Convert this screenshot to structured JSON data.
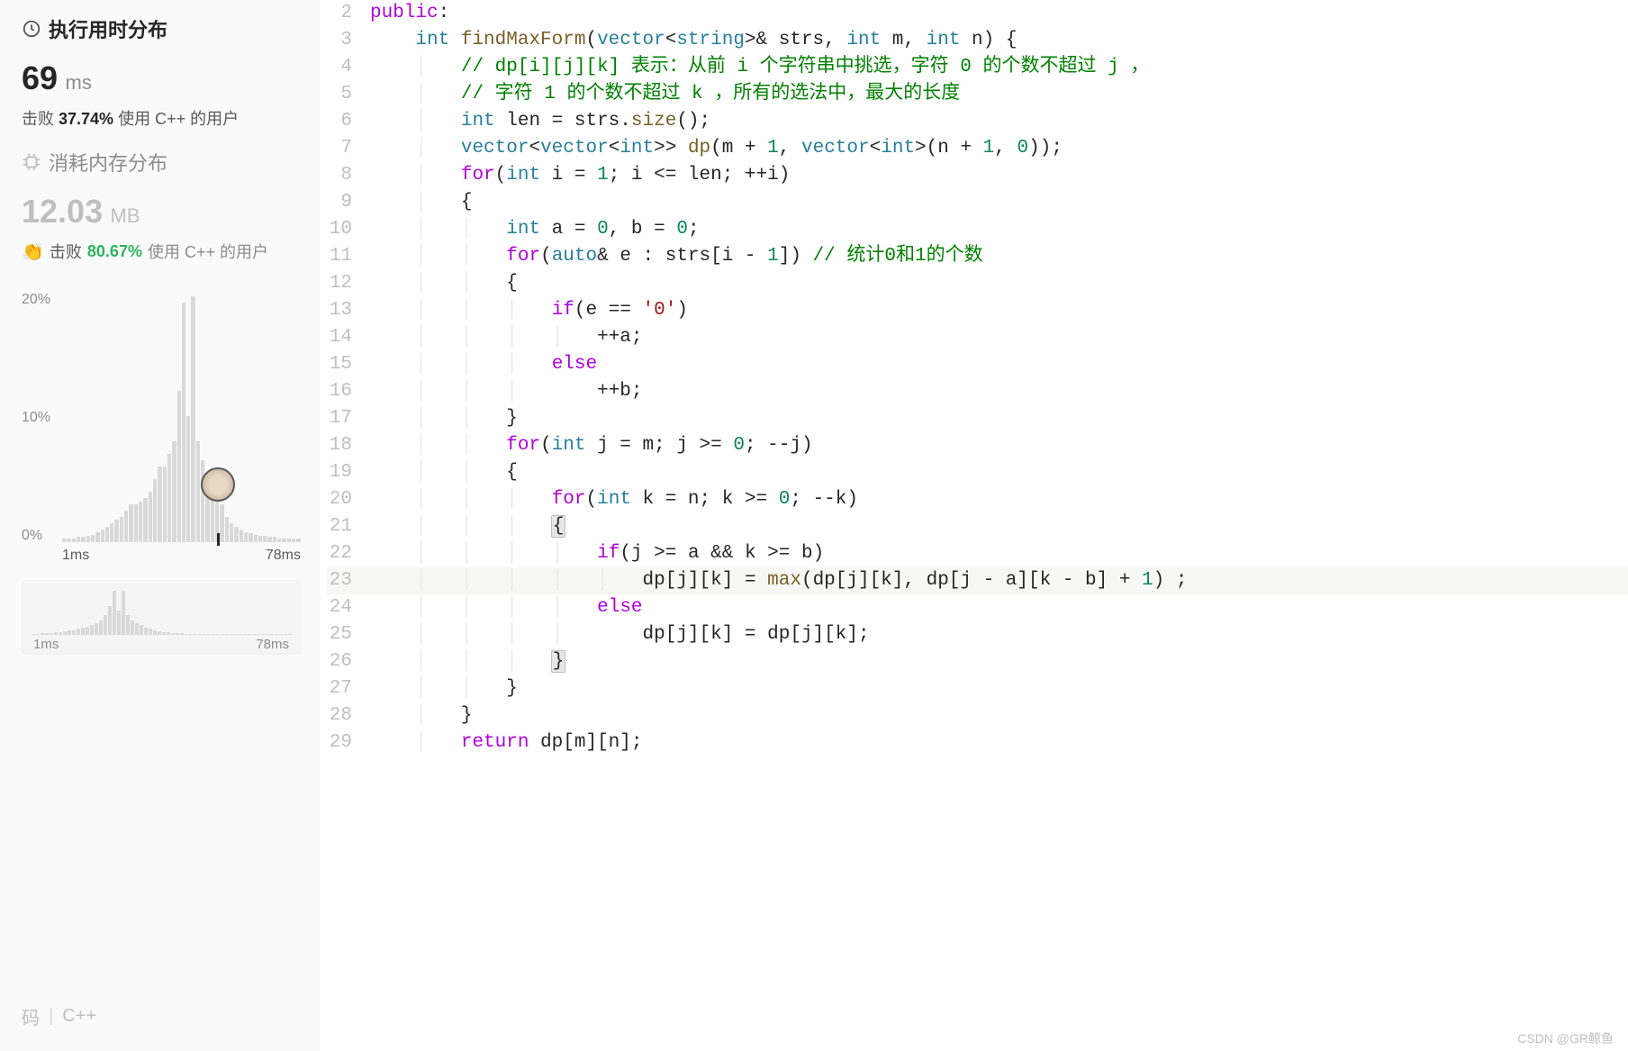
{
  "sidebar": {
    "runtime": {
      "header": "执行用时分布",
      "value": "69",
      "unit": "ms",
      "beat_label": "击败",
      "beat_pct": "37.74%",
      "beat_suffix": "使用 C++ 的用户"
    },
    "memory": {
      "header": "消耗内存分布",
      "value": "12.03",
      "unit": "MB",
      "beat_label": "击败",
      "beat_pct": "80.67%",
      "beat_suffix": "使用 C++ 的用户"
    },
    "y_axis": {
      "top": "20%",
      "mid": "10%",
      "bot": "0%"
    },
    "x_axis": {
      "left": "1ms",
      "right": "78ms"
    },
    "mini_x": {
      "left": "1ms",
      "right": "78ms"
    },
    "bottom": {
      "code": "码",
      "lang": "C++"
    }
  },
  "chart_data": {
    "type": "bar",
    "title": "执行用时分布",
    "xlabel": "ms",
    "ylabel": "percent",
    "ylim": [
      0,
      20
    ],
    "x_range": [
      "1ms",
      "78ms"
    ],
    "bars_pct": [
      0.3,
      0.3,
      0.3,
      0.4,
      0.4,
      0.5,
      0.6,
      0.8,
      1.0,
      1.2,
      1.5,
      1.8,
      2.0,
      2.5,
      3.0,
      3.0,
      3.2,
      3.5,
      4.0,
      5.0,
      6.0,
      6.0,
      7.0,
      8.0,
      12.0,
      19.0,
      10.0,
      19.5,
      8.0,
      6.5,
      5.0,
      4.0,
      4.0,
      3.0,
      2.0,
      1.5,
      1.2,
      1.0,
      0.8,
      0.7,
      0.6,
      0.5,
      0.5,
      0.4,
      0.4,
      0.3,
      0.3,
      0.3,
      0.3,
      0.3
    ],
    "mini_bars_pct": [
      0.5,
      0.5,
      0.6,
      0.7,
      0.8,
      1.0,
      1.2,
      1.5,
      1.8,
      2.0,
      2.5,
      3.0,
      3.5,
      4.0,
      5.0,
      6.0,
      8.0,
      12.0,
      18.0,
      10.0,
      18.0,
      8.0,
      6.0,
      5.0,
      4.0,
      3.0,
      2.5,
      2.0,
      1.5,
      1.2,
      1.0,
      0.8,
      0.7,
      0.6,
      0.5,
      0.5,
      0.4,
      0.4,
      0.4,
      0.3,
      0.3,
      0.3,
      0.3,
      0.3,
      0.3,
      0.2,
      0.2,
      0.2,
      0.2,
      0.2,
      0.2,
      0.2,
      0.2,
      0.2,
      0.2,
      0.2,
      0.2,
      0.2
    ]
  },
  "code": {
    "lines": [
      {
        "n": 2,
        "html": "<span class='kw'>public</span>:"
      },
      {
        "n": 3,
        "html": "    <span class='type'>int</span> <span class='fn'>findMaxForm</span>(<span class='type'>vector</span>&lt;<span class='type'>string</span>&gt;&amp; strs, <span class='type'>int</span> m, <span class='type'>int</span> n) {"
      },
      {
        "n": 4,
        "html": "    <span class='indent-guide'>│</span>   <span class='com'>// dp[i][j][k] 表示：从前 i 个字符串中挑选，字符 0 的个数不超过 j ，</span>"
      },
      {
        "n": 5,
        "html": "    <span class='indent-guide'>│</span>   <span class='com'>// 字符 1 的个数不超过 k ，所有的选法中，最大的长度</span>"
      },
      {
        "n": 6,
        "html": "    <span class='indent-guide'>│</span>   <span class='type'>int</span> len = strs.<span class='fn'>size</span>();"
      },
      {
        "n": 7,
        "html": "    <span class='indent-guide'>│</span>   <span class='type'>vector</span>&lt;<span class='type'>vector</span>&lt;<span class='type'>int</span>&gt;&gt; <span class='fn'>dp</span>(m + <span class='num'>1</span>, <span class='type'>vector</span>&lt;<span class='type'>int</span>&gt;(n + <span class='num'>1</span>, <span class='num'>0</span>));"
      },
      {
        "n": 8,
        "html": "    <span class='indent-guide'>│</span>   <span class='kw'>for</span>(<span class='type'>int</span> i = <span class='num'>1</span>; i &lt;= len; ++i)"
      },
      {
        "n": 9,
        "html": "    <span class='indent-guide'>│</span>   {"
      },
      {
        "n": 10,
        "html": "    <span class='indent-guide'>│</span>   <span class='indent-guide'>│</span>   <span class='type'>int</span> a = <span class='num'>0</span>, b = <span class='num'>0</span>;"
      },
      {
        "n": 11,
        "html": "    <span class='indent-guide'>│</span>   <span class='indent-guide'>│</span>   <span class='kw'>for</span>(<span class='type'>auto</span>&amp; e : strs[i - <span class='num'>1</span>]) <span class='com'>// 统计0和1的个数</span>"
      },
      {
        "n": 12,
        "html": "    <span class='indent-guide'>│</span>   <span class='indent-guide'>│</span>   {"
      },
      {
        "n": 13,
        "html": "    <span class='indent-guide'>│</span>   <span class='indent-guide'>│</span>   <span class='indent-guide'>│</span>   <span class='kw'>if</span>(e == <span class='str'>'0'</span>)"
      },
      {
        "n": 14,
        "html": "    <span class='indent-guide'>│</span>   <span class='indent-guide'>│</span>   <span class='indent-guide'>│</span>   <span class='indent-guide'>│</span>   ++a;"
      },
      {
        "n": 15,
        "html": "    <span class='indent-guide'>│</span>   <span class='indent-guide'>│</span>   <span class='indent-guide'>│</span>   <span class='kw'>else</span>"
      },
      {
        "n": 16,
        "html": "    <span class='indent-guide'>│</span>   <span class='indent-guide'>│</span>   <span class='indent-guide'>│</span>       ++b;"
      },
      {
        "n": 17,
        "html": "    <span class='indent-guide'>│</span>   <span class='indent-guide'>│</span>   }"
      },
      {
        "n": 18,
        "html": "    <span class='indent-guide'>│</span>   <span class='indent-guide'>│</span>   <span class='kw'>for</span>(<span class='type'>int</span> j = m; j &gt;= <span class='num'>0</span>; --j)"
      },
      {
        "n": 19,
        "html": "    <span class='indent-guide'>│</span>   <span class='indent-guide'>│</span>   {"
      },
      {
        "n": 20,
        "html": "    <span class='indent-guide'>│</span>   <span class='indent-guide'>│</span>   <span class='indent-guide'>│</span>   <span class='kw'>for</span>(<span class='type'>int</span> k = n; k &gt;= <span class='num'>0</span>; --k)"
      },
      {
        "n": 21,
        "html": "    <span class='indent-guide'>│</span>   <span class='indent-guide'>│</span>   <span class='indent-guide'>│</span>   <span class='brace-hl'>{</span>"
      },
      {
        "n": 22,
        "html": "    <span class='indent-guide'>│</span>   <span class='indent-guide'>│</span>   <span class='indent-guide'>│</span>   <span class='indent-guide'>│</span>   <span class='kw'>if</span>(j &gt;= a &amp;&amp; k &gt;= b)"
      },
      {
        "n": 23,
        "hl": true,
        "html": "    <span class='indent-guide'>│</span>   <span class='indent-guide'>│</span>   <span class='indent-guide'>│</span>   <span class='indent-guide'>│</span>   <span class='indent-guide'>│</span>   dp[j][k] = <span class='fn'>max</span>(dp[j][k], dp[j - a][k - b] + <span class='num'>1</span>) ;"
      },
      {
        "n": 24,
        "html": "    <span class='indent-guide'>│</span>   <span class='indent-guide'>│</span>   <span class='indent-guide'>│</span>   <span class='indent-guide'>│</span>   <span class='kw'>else</span>"
      },
      {
        "n": 25,
        "html": "    <span class='indent-guide'>│</span>   <span class='indent-guide'>│</span>   <span class='indent-guide'>│</span>   <span class='indent-guide'>│</span>       dp[j][k] = dp[j][k];"
      },
      {
        "n": 26,
        "html": "    <span class='indent-guide'>│</span>   <span class='indent-guide'>│</span>   <span class='indent-guide'>│</span>   <span class='brace-hl'>}</span>"
      },
      {
        "n": 27,
        "html": "    <span class='indent-guide'>│</span>   <span class='indent-guide'>│</span>   }"
      },
      {
        "n": 28,
        "html": "    <span class='indent-guide'>│</span>   }"
      },
      {
        "n": 29,
        "html": "    <span class='indent-guide'>│</span>   <span class='kw'>return</span> dp[m][n];"
      }
    ]
  },
  "watermark": "CSDN @GR鲸鱼"
}
